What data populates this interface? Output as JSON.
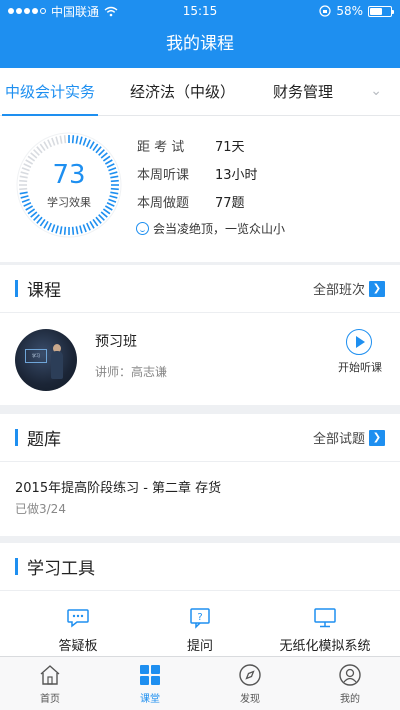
{
  "status_bar": {
    "carrier": "中国联通",
    "time": "15:15",
    "battery": "58%",
    "battery_fraction": 0.58
  },
  "nav": {
    "title": "我的课程"
  },
  "tabs": [
    {
      "label": "中级会计实务",
      "active": true
    },
    {
      "label": "经济法（中级）",
      "active": false
    },
    {
      "label": "财务管理",
      "active": false
    }
  ],
  "stats": {
    "score": "73",
    "score_label": "学习效果",
    "rows": [
      {
        "key": "距 考 试",
        "value": "71天"
      },
      {
        "key": "本周听课",
        "value": "13小时"
      },
      {
        "key": "本周做题",
        "value": "77题"
      }
    ],
    "motto": "会当凌绝顶，一览众山小"
  },
  "courses": {
    "title": "课程",
    "more": "全部班次",
    "item": {
      "name": "预习班",
      "teacher": "讲师：高志谦",
      "action": "开始听课"
    }
  },
  "question_bank": {
    "title": "题库",
    "more": "全部试题",
    "item": {
      "title": "2015年提高阶段练习 - 第二章 存货",
      "status": "已做3/24"
    }
  },
  "tools": {
    "title": "学习工具",
    "items": [
      {
        "label": "答疑板",
        "icon": "chat-bubble-icon"
      },
      {
        "label": "提问",
        "icon": "question-icon"
      },
      {
        "label": "无纸化模拟系统",
        "icon": "monitor-icon"
      }
    ]
  },
  "tabbar": [
    {
      "label": "首页",
      "icon": "home-icon"
    },
    {
      "label": "课堂",
      "icon": "grid-icon",
      "active": true
    },
    {
      "label": "发现",
      "icon": "compass-icon"
    },
    {
      "label": "我的",
      "icon": "profile-icon"
    }
  ],
  "colors": {
    "accent": "#1e8ff0",
    "background": "#eef0f3"
  }
}
